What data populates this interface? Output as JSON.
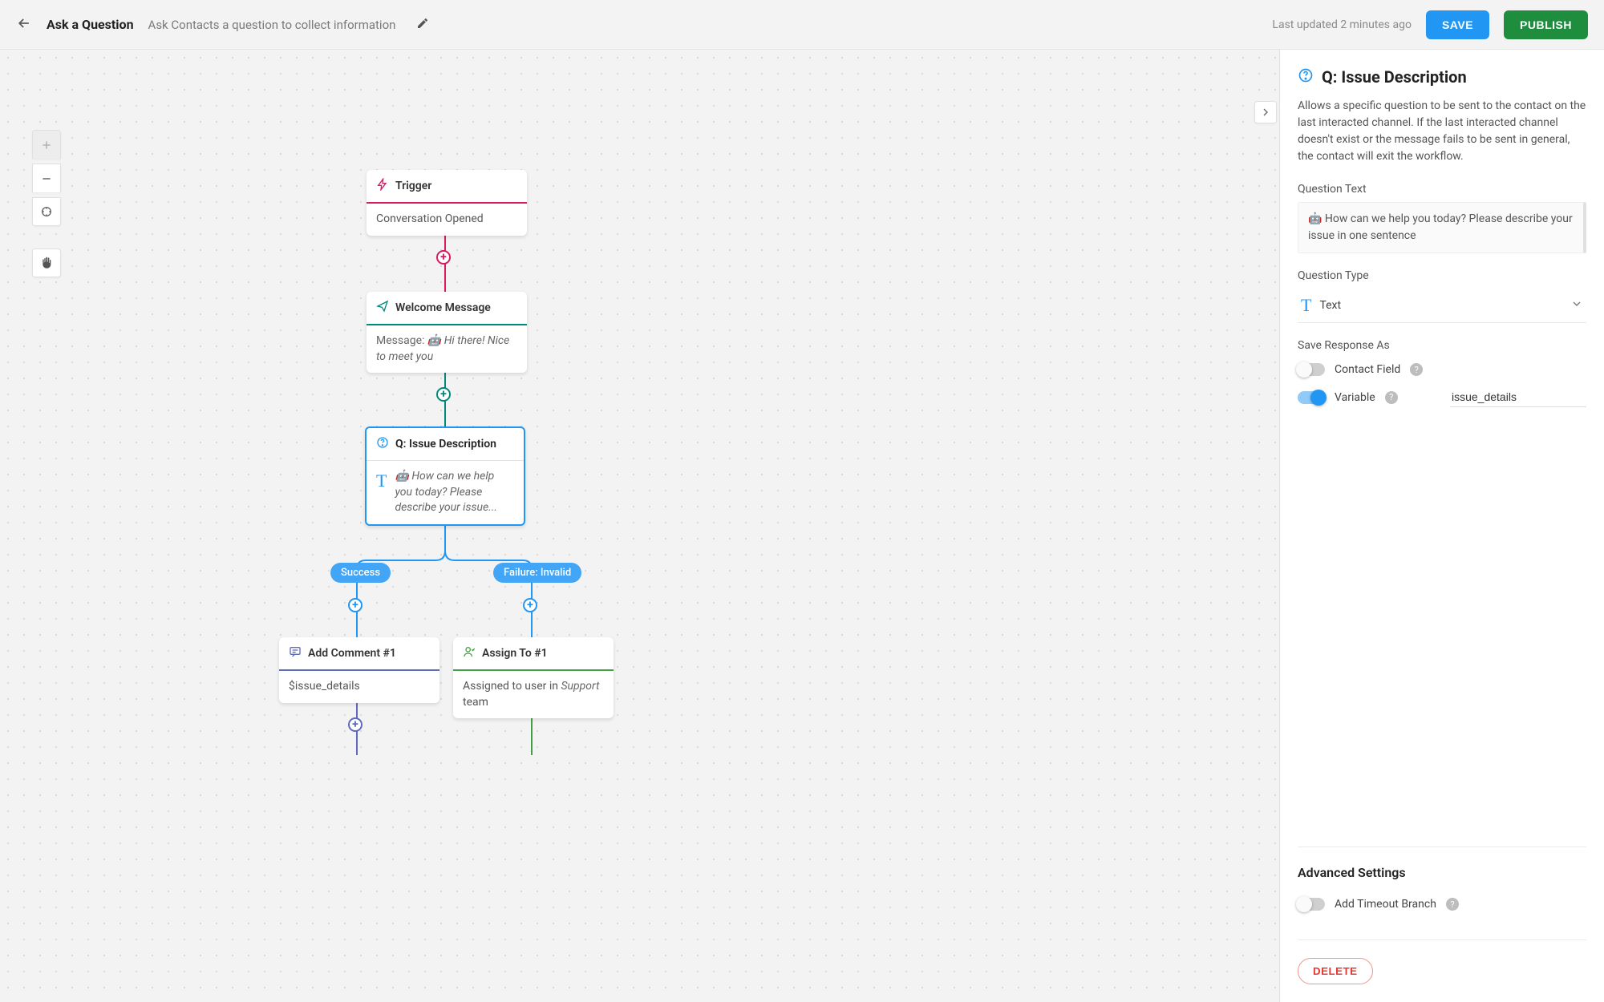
{
  "header": {
    "title": "Ask a Question",
    "subtitle": "Ask Contacts a question to collect information",
    "last_updated": "Last updated 2 minutes ago",
    "save_label": "SAVE",
    "publish_label": "PUBLISH"
  },
  "flow": {
    "trigger": {
      "title": "Trigger",
      "body": "Conversation Opened"
    },
    "welcome": {
      "title": "Welcome Message",
      "msg_label": "Message:",
      "body": "🤖 Hi there! Nice to meet you"
    },
    "question": {
      "title": "Q: Issue Description",
      "body": "🤖 How can we help you today? Please describe your issue..."
    },
    "branch_success": "Success",
    "branch_failure": "Failure: Invalid",
    "comment": {
      "title": "Add Comment #1",
      "body": "$issue_details"
    },
    "assign": {
      "title": "Assign To #1",
      "body_pre": "Assigned to user in ",
      "body_em": "Support",
      "body_post": " team"
    }
  },
  "inspector": {
    "title": "Q: Issue Description",
    "description": "Allows a specific question to be sent to the contact on the last interacted channel. If the last interacted channel doesn't exist or the message fails to be sent in general, the contact will exit the workflow.",
    "question_text_label": "Question Text",
    "question_text": "🤖 How can we help you today? Please describe your issue in one sentence",
    "question_type_label": "Question Type",
    "question_type_value": "Text",
    "save_response_label": "Save Response As",
    "contact_field_label": "Contact Field",
    "variable_label": "Variable",
    "variable_value": "issue_details",
    "advanced_label": "Advanced Settings",
    "timeout_label": "Add Timeout Branch",
    "delete_label": "DELETE"
  }
}
